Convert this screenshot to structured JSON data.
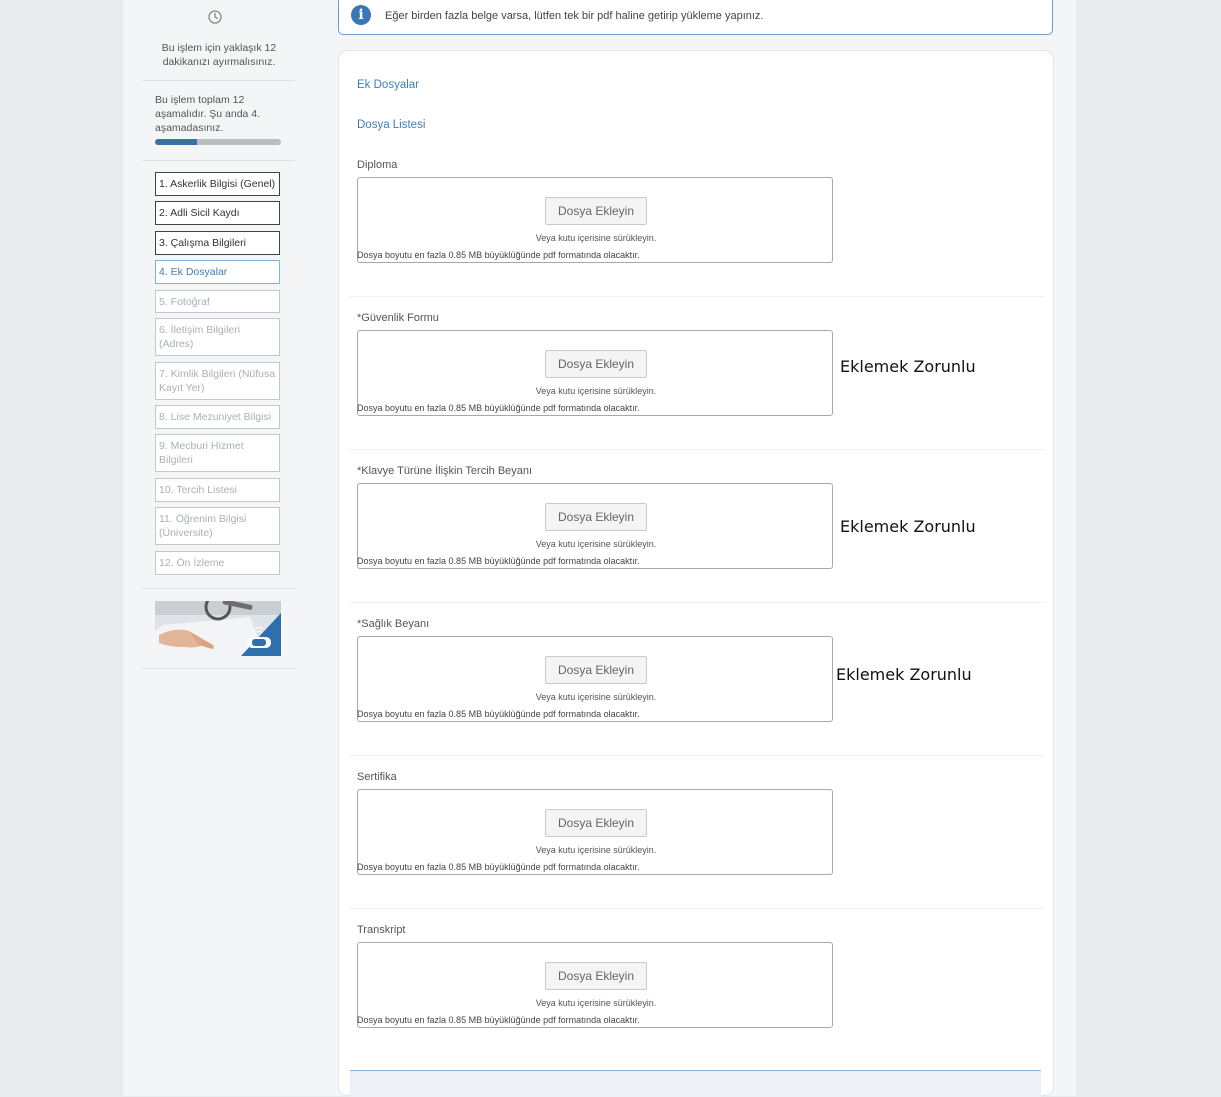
{
  "sidebar": {
    "time_note": "Bu işlem için yaklaşık 12 dakikanızı ayırmalısınız.",
    "step_note": "Bu işlem toplam 12 aşamalıdır. Şu anda 4. aşamadasınız.",
    "progress": {
      "current": 4,
      "total": 12
    },
    "steps": [
      {
        "label": "1. Askerlik Bilgisi (Genel)",
        "state": "done"
      },
      {
        "label": "2. Adli Sicil Kaydı",
        "state": "done"
      },
      {
        "label": "3. Çalışma Bilgileri",
        "state": "done"
      },
      {
        "label": "4. Ek Dosyalar",
        "state": "active"
      },
      {
        "label": "5. Fotoğraf",
        "state": "pending"
      },
      {
        "label": "6. İletişim Bilgileri (Adres)",
        "state": "pending"
      },
      {
        "label": "7. Kimlik Bilgileri (Nüfusa Kayıt Yer)",
        "state": "pending"
      },
      {
        "label": "8. Lise Mezuniyet Bilgisi",
        "state": "pending"
      },
      {
        "label": "9. Mecburi Hizmet Bilgileri",
        "state": "pending"
      },
      {
        "label": "10. Tercih Listesi",
        "state": "pending"
      },
      {
        "label": "11. Öğrenim Bilgisi (Üniversite)",
        "state": "pending"
      },
      {
        "label": "12. Ön İzleme",
        "state": "pending"
      }
    ]
  },
  "info_banner": {
    "icon": "info-icon",
    "text": "Eğer birden fazla belge varsa, lütfen tek bir pdf haline getirip yükleme yapınız."
  },
  "main": {
    "section_title": "Ek Dosyalar",
    "list_title": "Dosya Listesi",
    "add_button_label": "Dosya Ekleyin",
    "drop_hint": "Veya kutu içerisine sürükleyin.",
    "size_note": "Dosya boyutu en fazla 0.85 MB büyüklüğünde pdf formatında olacaktır.",
    "documents": [
      {
        "label": "Diploma",
        "required_note": ""
      },
      {
        "label": "*Güvenlik Formu",
        "required_note": "Eklemek Zorunlu"
      },
      {
        "label": "*Klavye Türüne İlişkin Tercih Beyanı",
        "required_note": "Eklemek Zorunlu"
      },
      {
        "label": "*Sağlık Beyanı",
        "required_note": "Eklemek Zorunlu"
      },
      {
        "label": "Sertifika",
        "required_note": ""
      },
      {
        "label": "Transkript",
        "required_note": ""
      }
    ]
  },
  "colors": {
    "accent": "#3d7fb3",
    "progress_fill": "#3b6fa6",
    "info_icon": "#3b77b5"
  }
}
